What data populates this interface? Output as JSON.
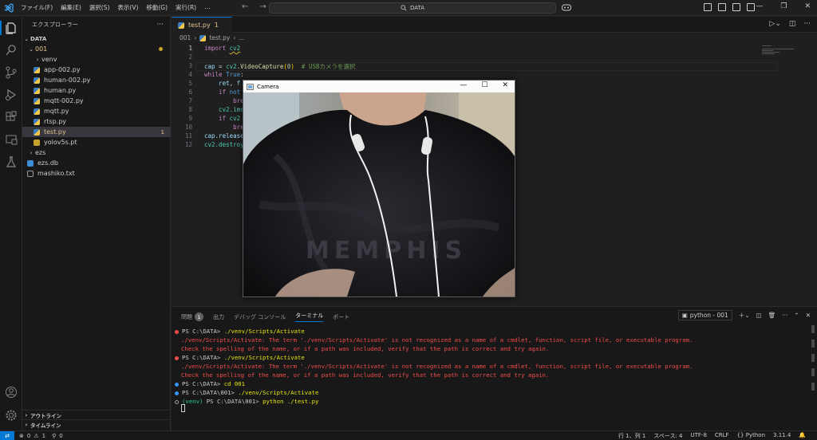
{
  "menu": [
    "ファイル(F)",
    "編集(E)",
    "選択(S)",
    "表示(V)",
    "移動(G)",
    "実行(R)",
    "…"
  ],
  "search": {
    "label": "DATA"
  },
  "explorer": {
    "title": "エクスプローラー",
    "root": "DATA",
    "folder": "001",
    "items": [
      {
        "label": "venv",
        "type": "folder"
      },
      {
        "label": "app-002.py",
        "type": "py"
      },
      {
        "label": "human-002.py",
        "type": "py"
      },
      {
        "label": "human.py",
        "type": "py"
      },
      {
        "label": "mqtt-002.py",
        "type": "py"
      },
      {
        "label": "mqtt.py",
        "type": "py"
      },
      {
        "label": "rtsp.py",
        "type": "py"
      },
      {
        "label": "test.py",
        "type": "py",
        "badge": "1"
      },
      {
        "label": "yolov5s.pt",
        "type": "pt"
      }
    ],
    "root_items": [
      {
        "label": "ezs",
        "type": "folder"
      },
      {
        "label": "ezs.db",
        "type": "db"
      },
      {
        "label": "mashiko.txt",
        "type": "txt"
      }
    ],
    "outline": "アウトライン",
    "timeline": "タイムライン"
  },
  "tab": {
    "label": "test.py",
    "badge": "1"
  },
  "breadcrumb": {
    "folder": "001",
    "file": "test.py",
    "more": "..."
  },
  "line_numbers": [
    "1",
    "2",
    "3",
    "4",
    "5",
    "6",
    "7",
    "8",
    "9",
    "10",
    "11",
    "12"
  ],
  "code": {
    "l1_kw": "import",
    "l1_mod": "cv2",
    "l3_var": "cap",
    "l3_eq": " = ",
    "l3_mod": "cv2",
    "l3_fn": ".VideoCapture",
    "l3_open": "(",
    "l3_num": "0",
    "l3_close": ")",
    "l3_cm": "  # USBカメラを選択",
    "l4_kw": "while",
    "l4_kwb": " True",
    "l4_colon": ":",
    "l5": "    ret, f",
    "l6_kw": "    if",
    "l6_kwb": " not",
    "l7": "        bre",
    "l8": "    cv2.ims",
    "l9_kw": "    if",
    "l9_rest": " cv2",
    "l10": "        bre",
    "l11": "cap.release",
    "l12": "cv2.destroy"
  },
  "camera": {
    "title": "Camera"
  },
  "panel": {
    "tabs": [
      "問題",
      "出力",
      "デバッグ コンソール",
      "ターミナル",
      "ポート"
    ],
    "problems_count": "1",
    "terminal_name": "python - 001"
  },
  "terminal": [
    {
      "dot": "err",
      "prompt": "PS C:\\DATA> ",
      "cmd": "./venv/Scripts/Activate"
    },
    {
      "dot": "",
      "err": "./venv/Scripts/Activate: The term './venv/Scripts/Activate' is not recognized as a name of a cmdlet, function, script file, or executable program."
    },
    {
      "dot": "",
      "err": "Check the spelling of the name, or if a path was included, verify that the path is correct and try again."
    },
    {
      "dot": "err",
      "prompt": "PS C:\\DATA> ",
      "cmd": "./venv/Scripts/Activate"
    },
    {
      "dot": "",
      "err": "./venv/Scripts/Activate: The term './venv/Scripts/Activate' is not recognized as a name of a cmdlet, function, script file, or executable program."
    },
    {
      "dot": "",
      "err": "Check the spelling of the name, or if a path was included, verify that the path is correct and try again."
    },
    {
      "dot": "ok",
      "prompt": "PS C:\\DATA> ",
      "cmd": "cd 001"
    },
    {
      "dot": "ok",
      "prompt": "PS C:\\DATA\\001> ",
      "cmd": "./venv/Scripts/Activate"
    },
    {
      "dot": "idle",
      "venv": "(venv) ",
      "prompt": "PS C:\\DATA\\001> ",
      "cmd": "python ./test.py"
    }
  ],
  "status": {
    "errors": "0",
    "warnings": "1",
    "ports": "0",
    "position": "行 1、列 1",
    "spaces": "スペース: 4",
    "encoding": "UTF-8",
    "eol": "CRLF",
    "language": "Python",
    "version": "3.11.4"
  },
  "icons": {
    "explorer": "files-icon",
    "search": "search-icon",
    "scm": "source-control-icon",
    "run": "run-debug-icon",
    "extensions": "extensions-icon",
    "remote": "remote-explorer-icon",
    "testing": "flask-icon",
    "account": "account-icon",
    "settings": "gear-icon"
  }
}
